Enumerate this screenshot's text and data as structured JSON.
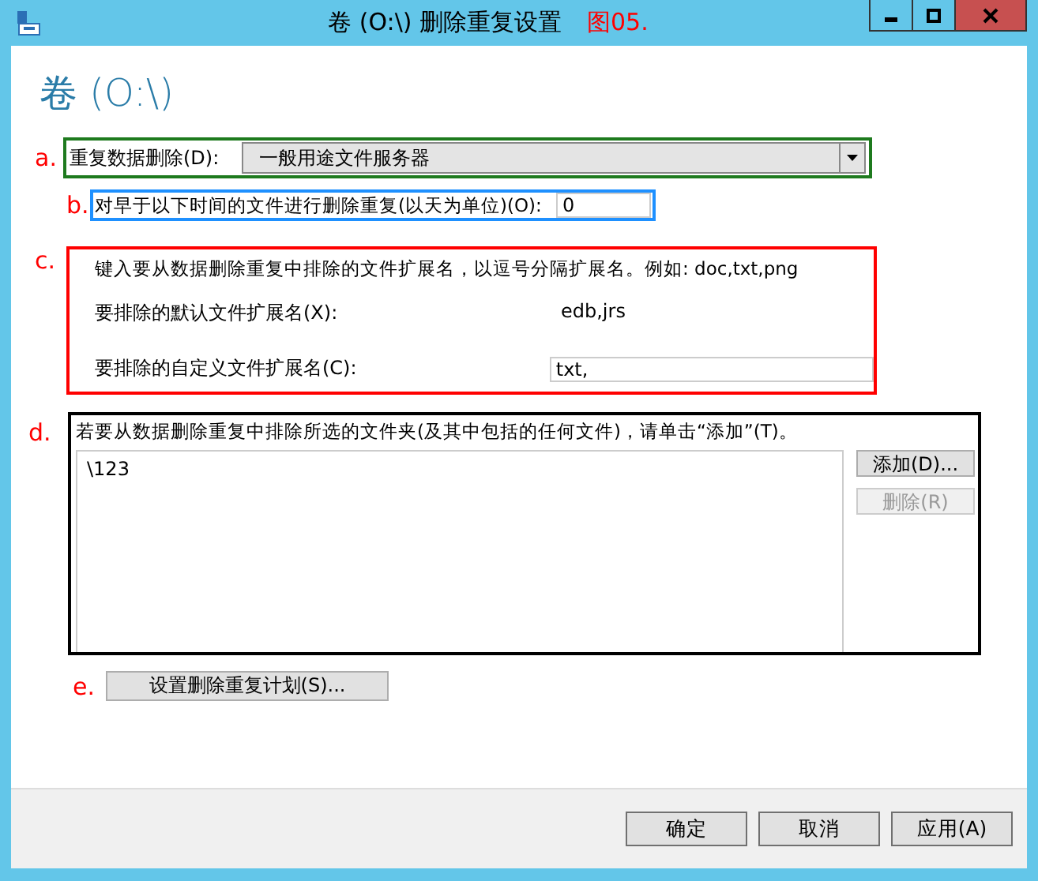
{
  "window": {
    "title": "卷 (O:\\) 删除重复设置",
    "title_annotation": "图05.",
    "controls": [
      {
        "kind": "minimize"
      },
      {
        "kind": "maximize"
      },
      {
        "kind": "close"
      }
    ]
  },
  "heading": "卷 (O:\\)",
  "dedup": {
    "marker": "a.",
    "label": "重复数据删除(D):",
    "value": "一般用途文件服务器"
  },
  "age": {
    "marker": "b.",
    "label": "对早于以下时间的文件进行删除重复(以天为单位)(O):",
    "value": "0"
  },
  "extensions": {
    "marker": "c.",
    "hint": "键入要从数据删除重复中排除的文件扩展名，以逗号分隔扩展名。例如: doc,txt,png",
    "default_label": "要排除的默认文件扩展名(X):",
    "default_value": "edb,jrs",
    "custom_label": "要排除的自定义文件扩展名(C):",
    "custom_value": "txt,"
  },
  "folders": {
    "marker": "d.",
    "hint": "若要从数据删除重复中排除所选的文件夹(及其中包括的任何文件)，请单击“添加”(T)。",
    "items": [
      "\\123"
    ],
    "buttons": [
      {
        "label": "添加(D)...",
        "disabled": false
      },
      {
        "label": "删除(R)",
        "disabled": true
      }
    ]
  },
  "schedule": {
    "marker": "e.",
    "button": "设置删除重复计划(S)..."
  },
  "footer_buttons": [
    {
      "label": "确定",
      "disabled": false
    },
    {
      "label": "取消",
      "disabled": false
    },
    {
      "label": "应用(A)",
      "disabled": false
    }
  ]
}
